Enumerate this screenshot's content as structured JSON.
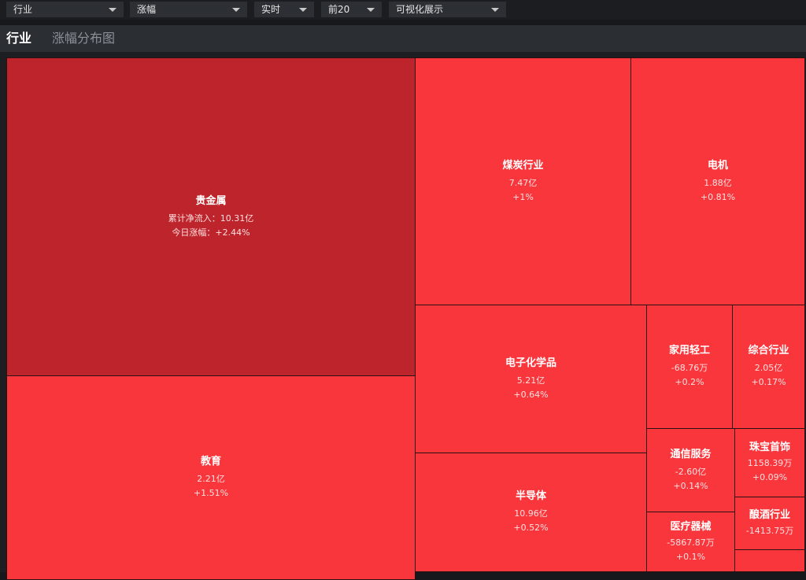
{
  "filters": {
    "category": "行业",
    "metric": "涨幅",
    "time": "实时",
    "top": "前20",
    "view": "可视化展示"
  },
  "header": {
    "active_tab": "行业",
    "inactive_tab": "涨幅分布图"
  },
  "main_tile": {
    "name": "贵金属",
    "flow_label": "累计净流入：",
    "flow": "10.31亿",
    "change_label": "今日涨幅：",
    "change": "+2.44%",
    "color": "#bd242b"
  },
  "tiles": {
    "education": {
      "name": "教育",
      "flow": "2.21亿",
      "change": "+1.51%"
    },
    "coal": {
      "name": "煤炭行业",
      "flow": "7.47亿",
      "change": "+1%"
    },
    "motor": {
      "name": "电机",
      "flow": "1.88亿",
      "change": "+0.81%"
    },
    "electro_chem": {
      "name": "电子化学品",
      "flow": "5.21亿",
      "change": "+0.64%"
    },
    "semiconductor": {
      "name": "半导体",
      "flow": "10.96亿",
      "change": "+0.52%"
    },
    "light_industry": {
      "name": "家用轻工",
      "flow": "-68.76万",
      "change": "+0.2%"
    },
    "comprehensive": {
      "name": "综合行业",
      "flow": "2.05亿",
      "change": "+0.17%"
    },
    "telecom": {
      "name": "通信服务",
      "flow": "-2.60亿",
      "change": "+0.14%"
    },
    "jewelry": {
      "name": "珠宝首饰",
      "flow": "1158.39万",
      "change": "+0.09%"
    },
    "medical": {
      "name": "医疗器械",
      "flow": "-5867.87万",
      "change": "+0.1%"
    },
    "liquor": {
      "name": "酿酒行业",
      "flow": "-1413.75万"
    }
  },
  "colors": {
    "tile_red": "#f8363c",
    "tile_dark_red": "#bd242b",
    "background": "#16181b",
    "header": "#2b2f34"
  }
}
